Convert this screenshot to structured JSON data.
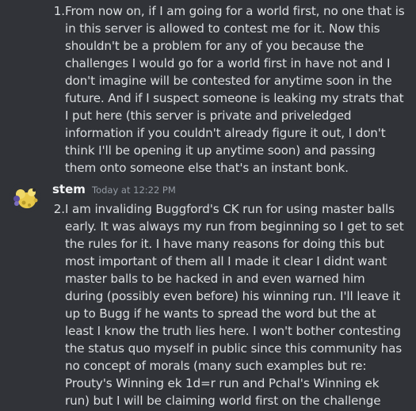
{
  "continued_message": {
    "number": "1.",
    "text": "From now on, if I am going for a world first, no one that is in this server is allowed to contest me for it. Now this shouldn't be a problem for any of you because the challenges I would go for a world first in have not and I don't imagine will be contested for anytime soon in the future. And if I suspect someone is leaking my strats that I put here (this server is private and priveledged information if you couldn't already figure it out, I don't think I'll be opening it up anytime soon) and passing them onto someone else that's an instant bonk."
  },
  "message": {
    "username": "stem",
    "timestamp": "Today at 12:22 PM",
    "avatar_icon": "yellow-pokemon-avatar-icon",
    "number": "2.",
    "text": "I am invaliding Buggford's CK run for using master balls early. It was always my run from beginning so I get to set the rules for it. I have many reasons for doing this but most important of them all I made it clear I didnt want master balls to be hacked in and even warned him during (possibly even before) his winning run. I'll leave it up to Bugg if he wants to spread the word but the at least I know the truth lies here. I won't bother contesting the status quo myself in public since this community has no concept of morals (many such examples but re: Prouty's Winning ek 1d=r run and Pchal's Winning ek run) but I will be claiming world first on the challenge once I finally beat it."
  },
  "colors": {
    "background": "#313338",
    "text": "#dbdee1",
    "username": "#f2f3f5",
    "timestamp": "#949ba4"
  }
}
